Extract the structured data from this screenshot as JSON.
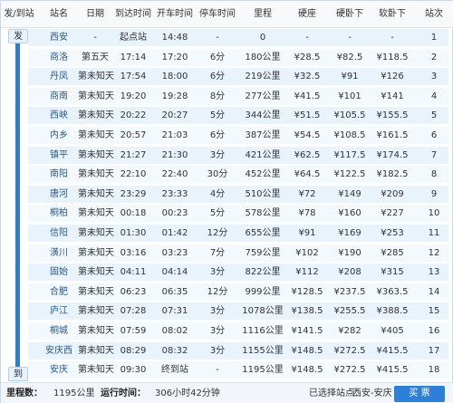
{
  "columns": {
    "from_to": "发/到站",
    "station": "站名",
    "date": "日期",
    "arrive": "到达时间",
    "depart": "开车时间",
    "stop": "停车时间",
    "mileage": "里程",
    "hard_seat": "硬座",
    "hard_sleeper": "硬卧下",
    "soft_sleeper": "软卧下",
    "seq": "站次"
  },
  "rail": {
    "start_label": "发",
    "end_label": "到"
  },
  "rows": [
    {
      "station": "西安",
      "date": "-",
      "arrive": "起点站",
      "depart": "14:48",
      "stop": "-",
      "mileage": "0",
      "hard_seat": "-",
      "hard_sleeper": "-",
      "soft_sleeper": "-",
      "seq": "1"
    },
    {
      "station": "商洛",
      "date": "第五天",
      "arrive": "17:14",
      "depart": "17:20",
      "stop": "6分",
      "mileage": "180公里",
      "hard_seat": "¥28.5",
      "hard_sleeper": "¥82.5",
      "soft_sleeper": "¥118.5",
      "seq": "2"
    },
    {
      "station": "丹凤",
      "date": "第未知天",
      "arrive": "17:54",
      "depart": "18:00",
      "stop": "6分",
      "mileage": "219公里",
      "hard_seat": "¥32.5",
      "hard_sleeper": "¥91",
      "soft_sleeper": "¥126",
      "seq": "3"
    },
    {
      "station": "商南",
      "date": "第未知天",
      "arrive": "19:20",
      "depart": "19:28",
      "stop": "8分",
      "mileage": "277公里",
      "hard_seat": "¥41.5",
      "hard_sleeper": "¥101",
      "soft_sleeper": "¥141",
      "seq": "4"
    },
    {
      "station": "西峡",
      "date": "第未知天",
      "arrive": "20:22",
      "depart": "20:27",
      "stop": "5分",
      "mileage": "344公里",
      "hard_seat": "¥51.5",
      "hard_sleeper": "¥105.5",
      "soft_sleeper": "¥155.5",
      "seq": "5"
    },
    {
      "station": "内乡",
      "date": "第未知天",
      "arrive": "20:57",
      "depart": "21:03",
      "stop": "6分",
      "mileage": "387公里",
      "hard_seat": "¥54.5",
      "hard_sleeper": "¥108.5",
      "soft_sleeper": "¥161.5",
      "seq": "6"
    },
    {
      "station": "镇平",
      "date": "第未知天",
      "arrive": "21:27",
      "depart": "21:30",
      "stop": "3分",
      "mileage": "421公里",
      "hard_seat": "¥62.5",
      "hard_sleeper": "¥117.5",
      "soft_sleeper": "¥174.5",
      "seq": "7"
    },
    {
      "station": "南阳",
      "date": "第未知天",
      "arrive": "22:10",
      "depart": "22:40",
      "stop": "30分",
      "mileage": "452公里",
      "hard_seat": "¥64.5",
      "hard_sleeper": "¥122.5",
      "soft_sleeper": "¥182.5",
      "seq": "8"
    },
    {
      "station": "唐河",
      "date": "第未知天",
      "arrive": "23:29",
      "depart": "23:33",
      "stop": "4分",
      "mileage": "510公里",
      "hard_seat": "¥72",
      "hard_sleeper": "¥149",
      "soft_sleeper": "¥209",
      "seq": "9"
    },
    {
      "station": "桐柏",
      "date": "第未知天",
      "arrive": "00:18",
      "depart": "00:23",
      "stop": "5分",
      "mileage": "578公里",
      "hard_seat": "¥78",
      "hard_sleeper": "¥160",
      "soft_sleeper": "¥227",
      "seq": "10"
    },
    {
      "station": "信阳",
      "date": "第未知天",
      "arrive": "01:30",
      "depart": "01:42",
      "stop": "12分",
      "mileage": "655公里",
      "hard_seat": "¥91",
      "hard_sleeper": "¥169",
      "soft_sleeper": "¥253",
      "seq": "11"
    },
    {
      "station": "潢川",
      "date": "第未知天",
      "arrive": "03:16",
      "depart": "03:23",
      "stop": "7分",
      "mileage": "759公里",
      "hard_seat": "¥102",
      "hard_sleeper": "¥190",
      "soft_sleeper": "¥285",
      "seq": "12"
    },
    {
      "station": "固始",
      "date": "第未知天",
      "arrive": "04:11",
      "depart": "04:14",
      "stop": "3分",
      "mileage": "822公里",
      "hard_seat": "¥112",
      "hard_sleeper": "¥208",
      "soft_sleeper": "¥315",
      "seq": "13"
    },
    {
      "station": "合肥",
      "date": "第未知天",
      "arrive": "06:23",
      "depart": "06:35",
      "stop": "12分",
      "mileage": "999公里",
      "hard_seat": "¥128.5",
      "hard_sleeper": "¥237.5",
      "soft_sleeper": "¥363.5",
      "seq": "14"
    },
    {
      "station": "庐江",
      "date": "第未知天",
      "arrive": "07:28",
      "depart": "07:31",
      "stop": "3分",
      "mileage": "1078公里",
      "hard_seat": "¥138.5",
      "hard_sleeper": "¥255.5",
      "soft_sleeper": "¥388.5",
      "seq": "15"
    },
    {
      "station": "桐城",
      "date": "第未知天",
      "arrive": "07:59",
      "depart": "08:02",
      "stop": "3分",
      "mileage": "1116公里",
      "hard_seat": "¥141.5",
      "hard_sleeper": "¥282",
      "soft_sleeper": "¥405",
      "seq": "16"
    },
    {
      "station": "安庆西",
      "date": "第未知天",
      "arrive": "08:29",
      "depart": "08:32",
      "stop": "3分",
      "mileage": "1155公里",
      "hard_seat": "¥148.5",
      "hard_sleeper": "¥272.5",
      "soft_sleeper": "¥415.5",
      "seq": "17"
    },
    {
      "station": "安庆",
      "date": "第未知天",
      "arrive": "09:30",
      "depart": "终到站",
      "stop": "-",
      "mileage": "1195公里",
      "hard_seat": "¥148.5",
      "hard_sleeper": "¥272.5",
      "soft_sleeper": "¥415.5",
      "seq": "18"
    }
  ],
  "footer": {
    "mileage_label": "里程数：",
    "mileage_value": "1195公里",
    "runtime_label": "运行时间：",
    "runtime_value": "306小时42分钟",
    "selected_label": "已选择站点：",
    "selected_value": "西安-安庆",
    "buy_label": "买 票"
  }
}
